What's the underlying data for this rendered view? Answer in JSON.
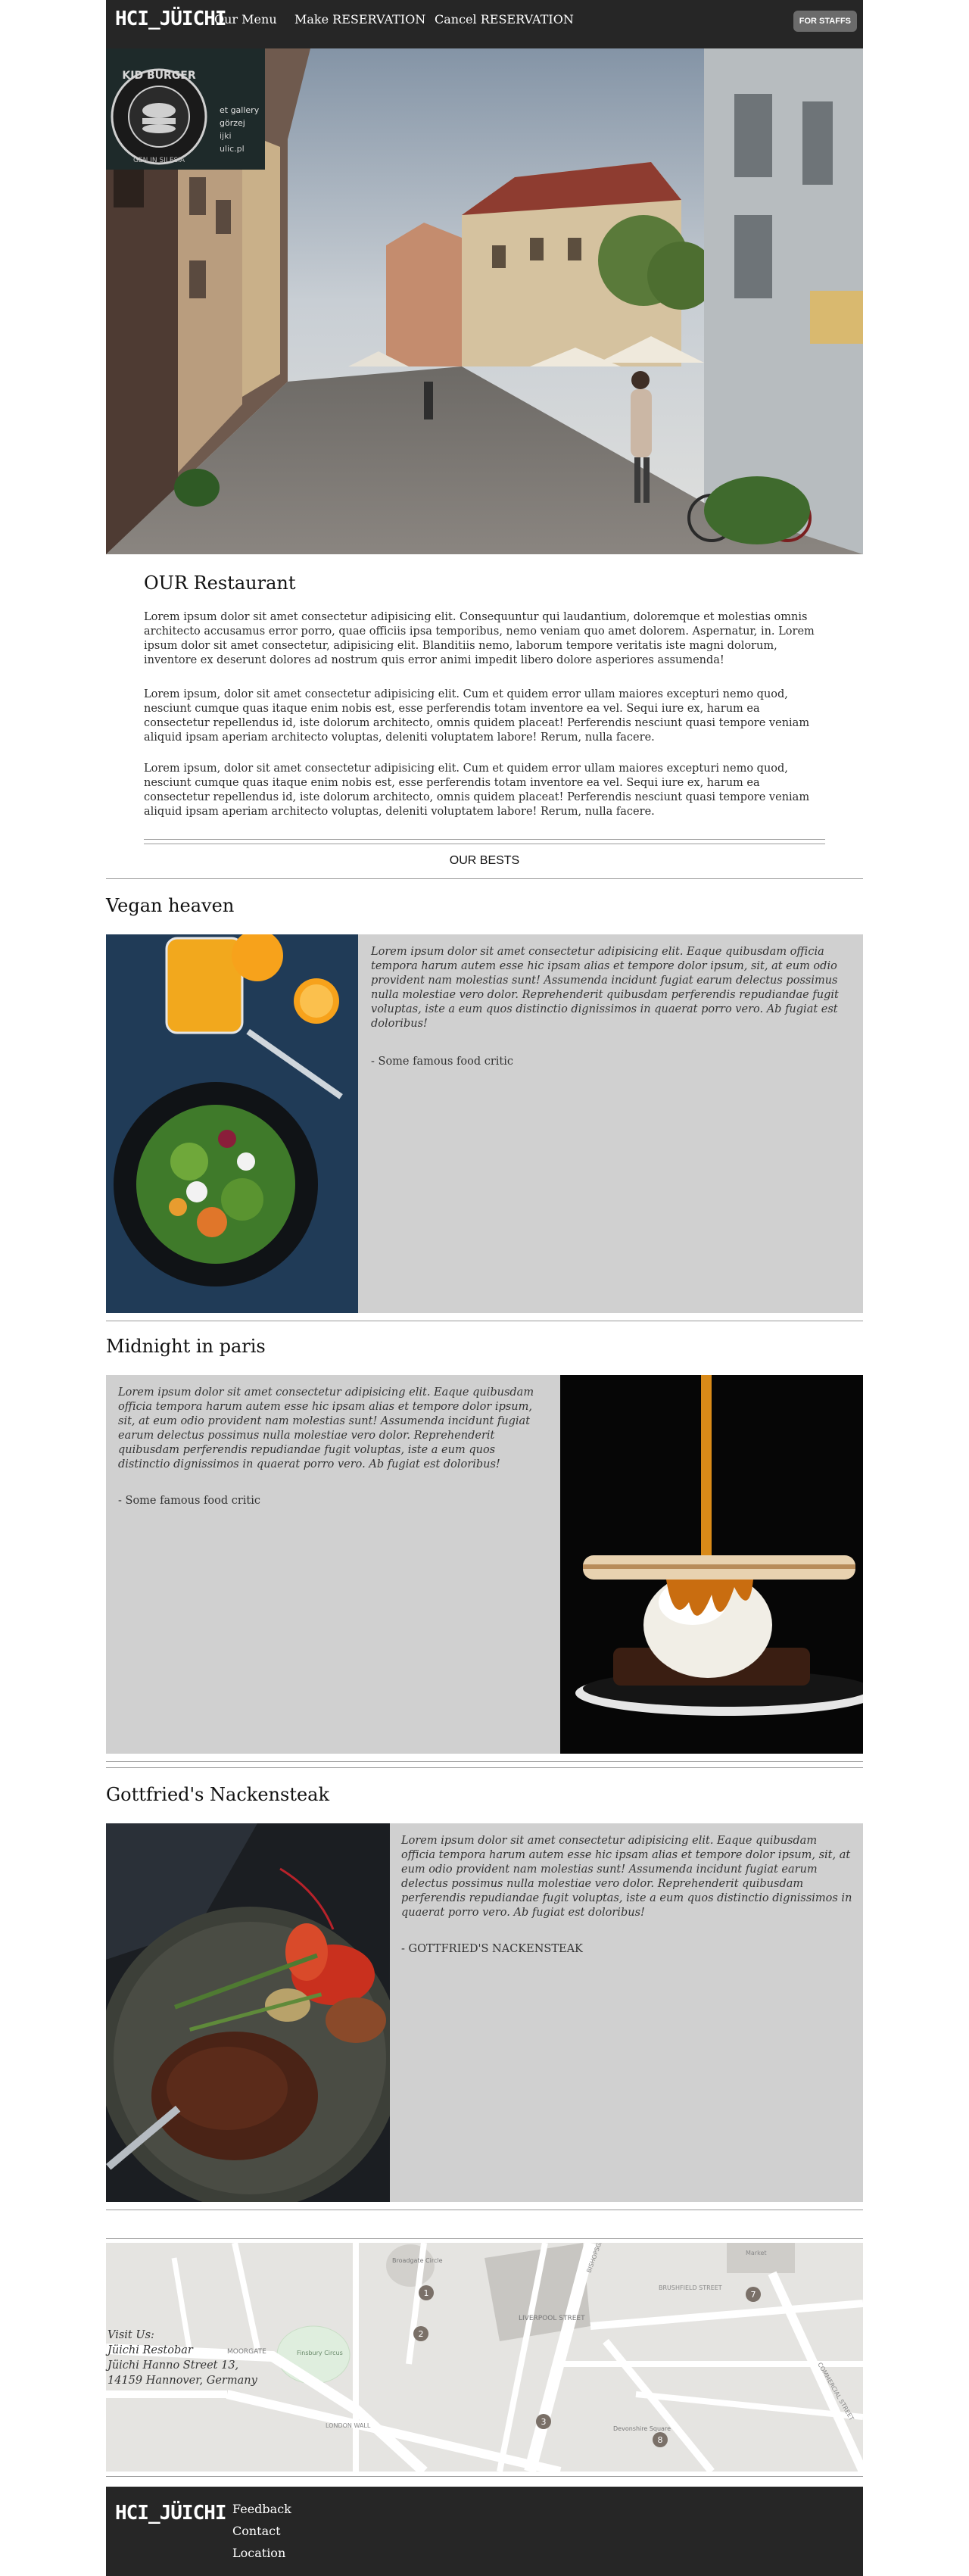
{
  "nav": {
    "brand": "HCI_JÜICHI",
    "links": [
      "Our Menu",
      "Make RESERVATION",
      "Cancel RESERVATION"
    ],
    "staff_button": "FOR STAFFS"
  },
  "hero": {
    "sign_text": "KID BURGER",
    "sign_bottom": "GEN IN SILESIA",
    "gallery_lines": [
      "et gallery",
      "görzej",
      "ijki",
      "ulic.pl"
    ]
  },
  "about": {
    "title": "OUR Restaurant",
    "paragraphs": [
      "Lorem ipsum dolor sit amet consectetur adipisicing elit. Consequuntur qui laudantium, doloremque et molestias omnis architecto accusamus error porro, quae officiis ipsa temporibus, nemo veniam quo amet dolorem. Aspernatur, in. Lorem ipsum dolor sit amet consectetur, adipisicing elit. Blanditiis nemo, laborum tempore veritatis iste magni dolorum, inventore ex deserunt dolores ad nostrum quis error animi impedit libero dolore asperiores assumenda!",
      "Lorem ipsum, dolor sit amet consectetur adipisicing elit. Cum et quidem error ullam maiores excepturi nemo quod, nesciunt cumque quas itaque enim nobis est, esse perferendis totam inventore ea vel. Sequi iure ex, harum ea consectetur repellendus id, iste dolorum architecto, omnis quidem placeat! Perferendis nesciunt quasi tempore veniam aliquid ipsam aperiam architecto voluptas, deleniti voluptatem labore! Rerum, nulla facere.",
      "Lorem ipsum, dolor sit amet consectetur adipisicing elit. Cum et quidem error ullam maiores excepturi nemo quod, nesciunt cumque quas itaque enim nobis est, esse perferendis totam inventore ea vel. Sequi iure ex, harum ea consectetur repellendus id, iste dolorum architecto, omnis quidem placeat! Perferendis nesciunt quasi tempore veniam aliquid ipsam aperiam architecto voluptas, deleniti voluptatem labore! Rerum, nulla facere."
    ]
  },
  "bests": {
    "heading": "OUR BESTS",
    "dishes": [
      {
        "title": "Vegan heaven",
        "quote": "Lorem ipsum dolor sit amet consectetur adipisicing elit. Eaque quibusdam officia tempora harum autem esse hic ipsam alias et tempore dolor ipsum, sit, at eum odio provident nam molestias sunt! Assumenda incidunt fugiat earum delectus possimus nulla molestiae vero dolor. Reprehenderit quibusdam perferendis repudiandae fugit voluptas, iste a eum quos distinctio dignissimos in quaerat porro vero. Ab fugiat est doloribus!",
        "cite": "- Some famous food critic"
      },
      {
        "title": "Midnight in paris",
        "quote": "Lorem ipsum dolor sit amet consectetur adipisicing elit. Eaque quibusdam officia tempora harum autem esse hic ipsam alias et tempore dolor ipsum, sit, at eum odio provident nam molestias sunt! Assumenda incidunt fugiat earum delectus possimus nulla molestiae vero dolor. Reprehenderit quibusdam perferendis repudiandae fugit voluptas, iste a eum quos distinctio dignissimos in quaerat porro vero. Ab fugiat est doloribus!",
        "cite": "- Some famous food critic"
      },
      {
        "title": "Gottfried's Nackensteak",
        "quote": "Lorem ipsum dolor sit amet consectetur adipisicing elit. Eaque quibusdam officia tempora harum autem esse hic ipsam alias et tempore dolor ipsum, sit, at eum odio provident nam molestias sunt! Assumenda incidunt fugiat earum delectus possimus nulla molestiae vero dolor. Reprehenderit quibusdam perferendis repudiandae fugit voluptas, iste a eum quos distinctio dignissimos in quaerat porro vero. Ab fugiat est doloribus!",
        "cite": "- GOTTFRIED'S NACKENSTEAK"
      }
    ]
  },
  "map": {
    "visit_lines": [
      "Visit Us:",
      "Jüichi Restobar",
      "Jüichi Hanno Street 13,",
      "14159 Hannover, Germany"
    ],
    "labels": {
      "moorgate": "MOORGATE",
      "liverpool": "LIVERPOOL STREET",
      "finsbury": "Finsbury Circus",
      "devonshire": "Devonshire Square",
      "broadgate": "Broadgate Circle",
      "london_wall": "LONDON WALL",
      "bishopsgate": "BISHOPSGATE",
      "brushfield": "BRUSHFIELD STREET",
      "commercial": "COMMERCIAL STREET",
      "market": "Market"
    },
    "markers": [
      "1",
      "2",
      "3",
      "7",
      "8"
    ]
  },
  "footer": {
    "brand": "HCI_JÜICHI",
    "links": [
      "Feedback",
      "Contact",
      "Location"
    ]
  }
}
